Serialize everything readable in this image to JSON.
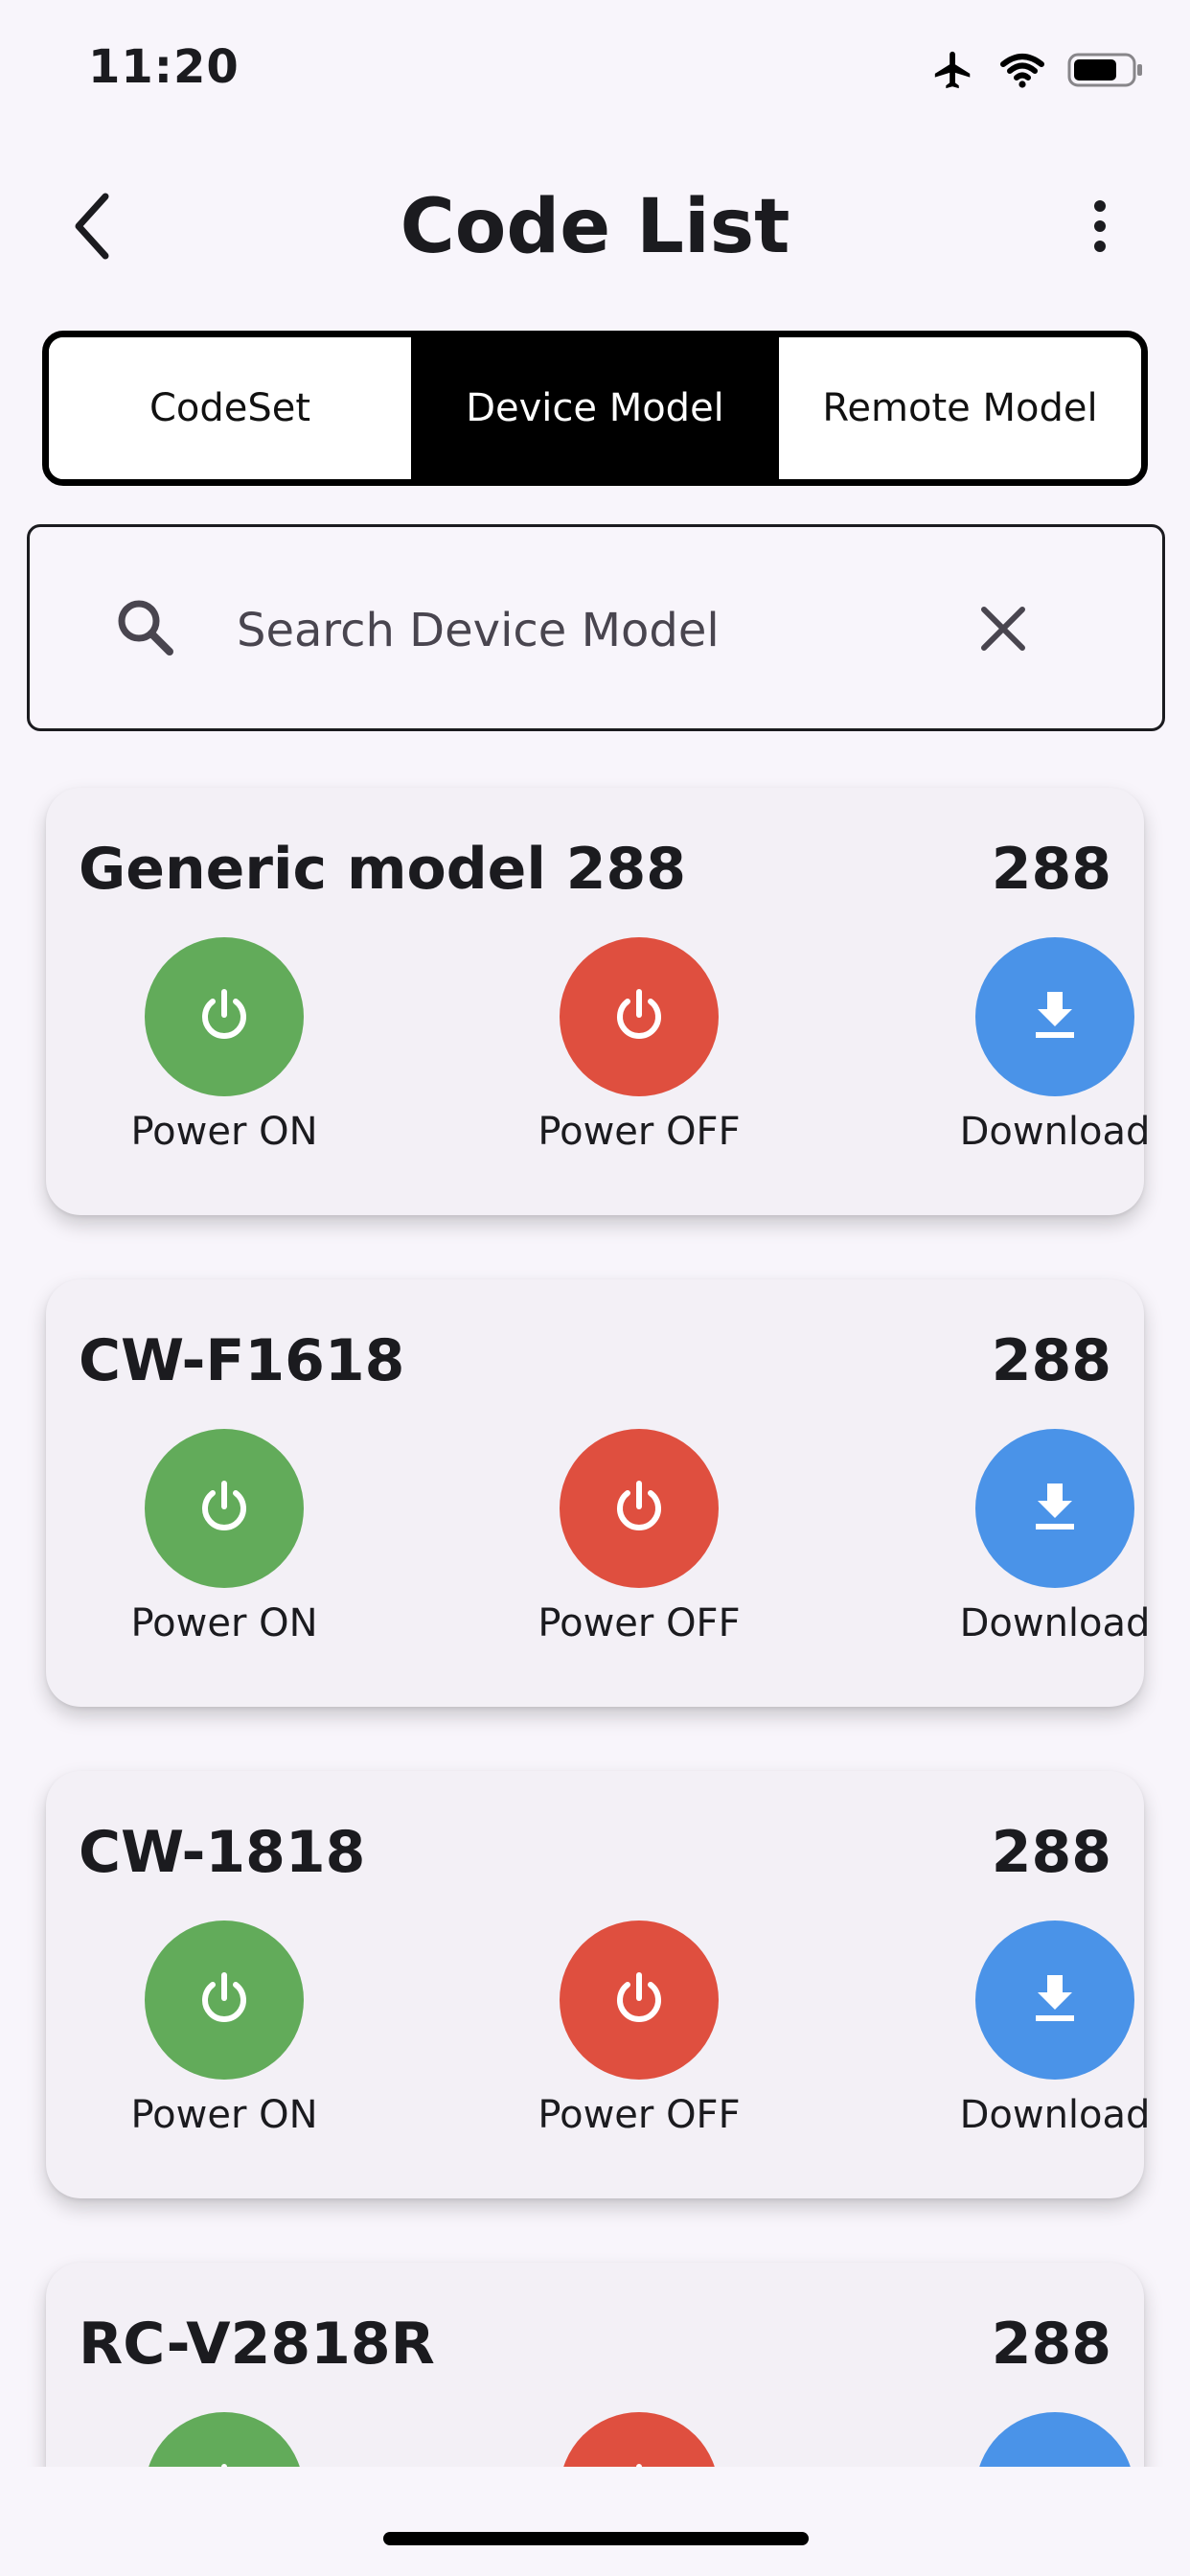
{
  "status_bar": {
    "time": "11:20",
    "icons": [
      "airplane-icon",
      "wifi-icon",
      "battery-icon"
    ]
  },
  "app_bar": {
    "title": "Code List",
    "back_icon": "chevron-left-icon",
    "menu_icon": "more-vertical-icon"
  },
  "tabs": [
    {
      "label": "CodeSet",
      "active": false
    },
    {
      "label": "Device Model",
      "active": true
    },
    {
      "label": "Remote Model",
      "active": false
    }
  ],
  "search": {
    "placeholder": "Search Device Model",
    "value": "",
    "search_icon": "search-icon",
    "clear_icon": "close-icon"
  },
  "action_labels": {
    "power_on": "Power ON",
    "power_off": "Power OFF",
    "download": "Download"
  },
  "colors": {
    "power_on": "#62AB5A",
    "power_off": "#DF4F3F",
    "download": "#4A93E8",
    "active_tab": "#000000",
    "background": "#F8F5FB",
    "card": "#F3F0F6"
  },
  "devices": [
    {
      "name": "Generic model 288",
      "count": "288"
    },
    {
      "name": "CW-F1618",
      "count": "288"
    },
    {
      "name": "CW-1818",
      "count": "288"
    },
    {
      "name": "RC-V2818R",
      "count": "288"
    }
  ]
}
